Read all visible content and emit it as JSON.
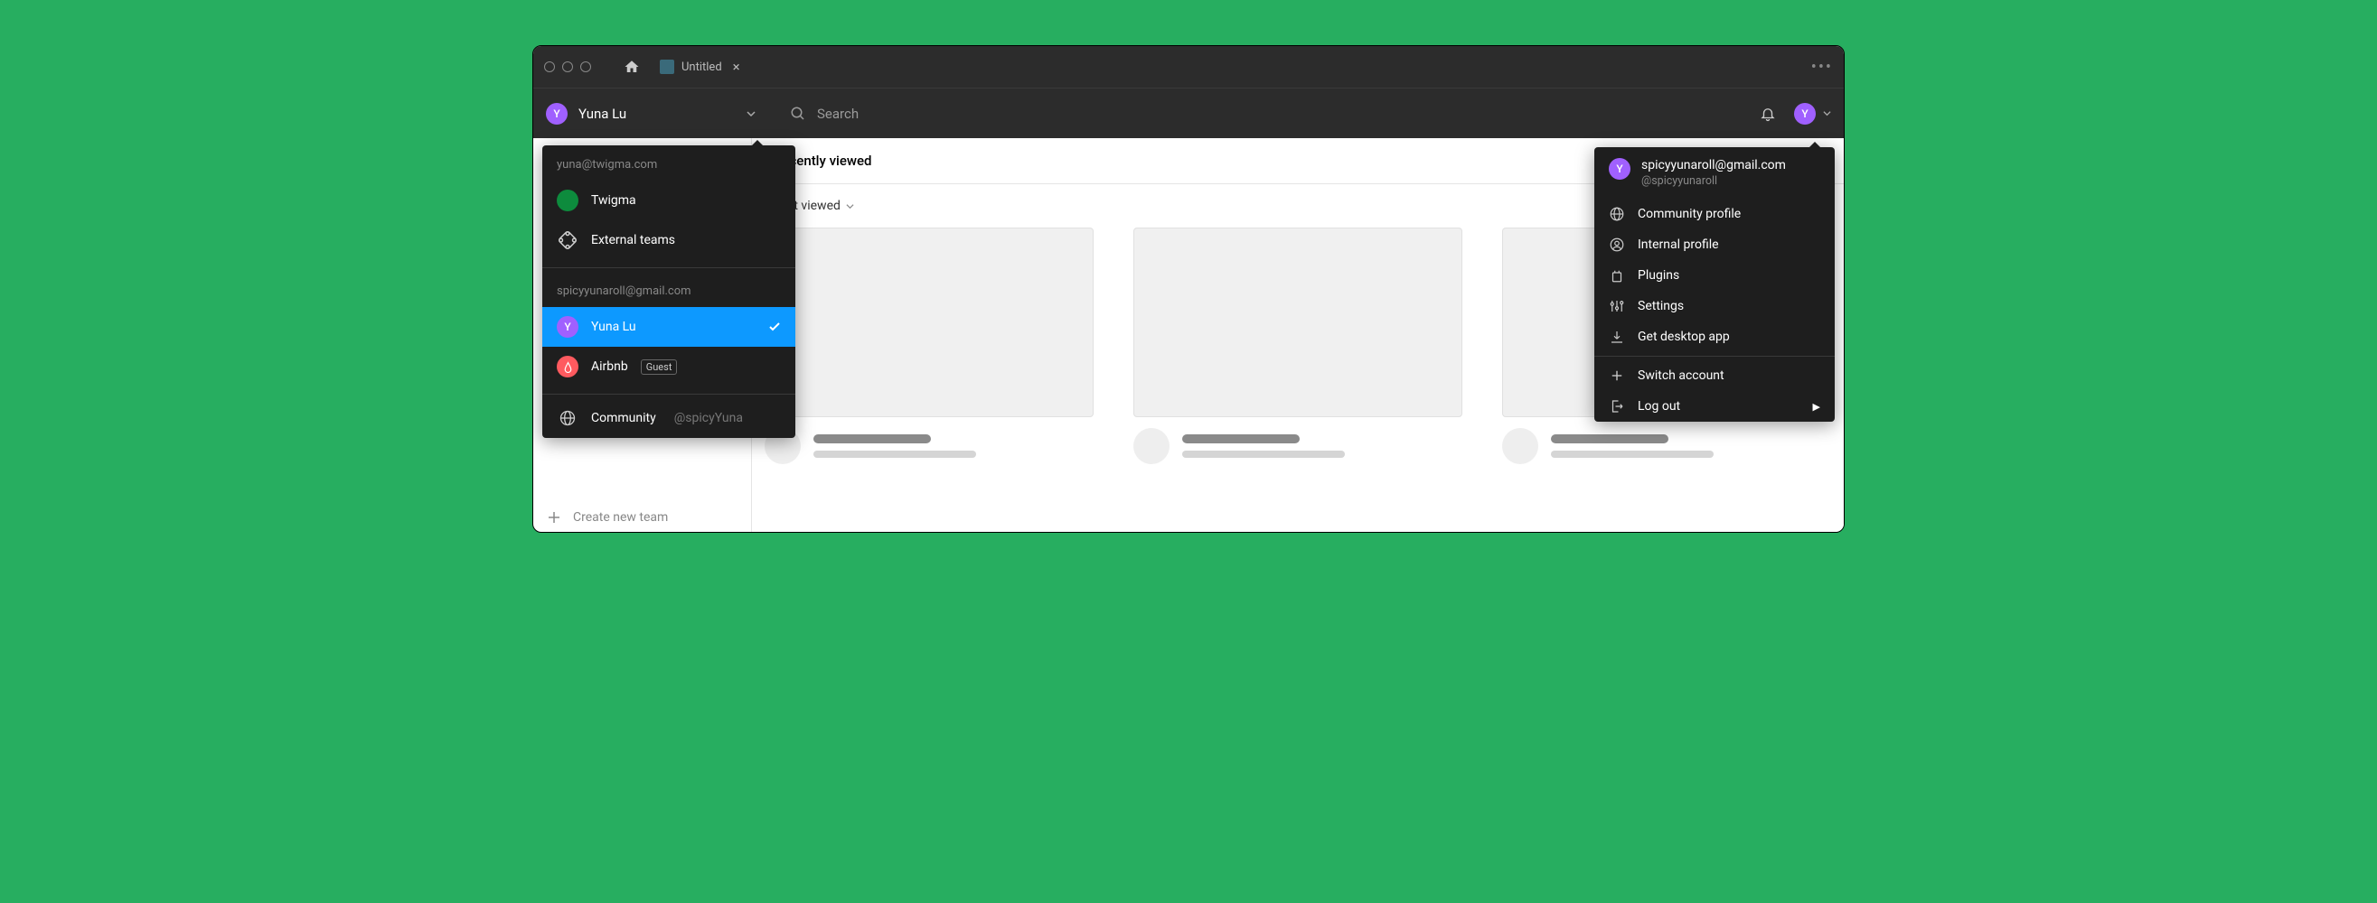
{
  "titlebar": {
    "tab_label": "Untitled"
  },
  "subbar": {
    "user_name": "Yuna Lu",
    "user_initial": "Y",
    "search_placeholder": "Search",
    "right_avatar_initial": "Y"
  },
  "sidebar": {
    "create_team_label": "Create new team"
  },
  "main": {
    "header": "Recently viewed",
    "filter_label": "Last viewed"
  },
  "left_dropdown": {
    "account1_email": "yuna@twigma.com",
    "account1_items": [
      {
        "label": "Twigma"
      },
      {
        "label": "External teams"
      }
    ],
    "account2_email": "spicyyunaroll@gmail.com",
    "account2_user": {
      "initial": "Y",
      "label": "Yuna Lu"
    },
    "account2_team": {
      "label": "Airbnb",
      "badge": "Guest"
    },
    "community_label": "Community",
    "community_handle": "@spicyYuna"
  },
  "right_dropdown": {
    "email": "spicyyunaroll@gmail.com",
    "handle": "@spicyyunaroll",
    "initial": "Y",
    "items": {
      "community_profile": "Community profile",
      "internal_profile": "Internal profile",
      "plugins": "Plugins",
      "settings": "Settings",
      "get_desktop": "Get desktop app",
      "switch_account": "Switch account",
      "log_out": "Log out"
    }
  }
}
